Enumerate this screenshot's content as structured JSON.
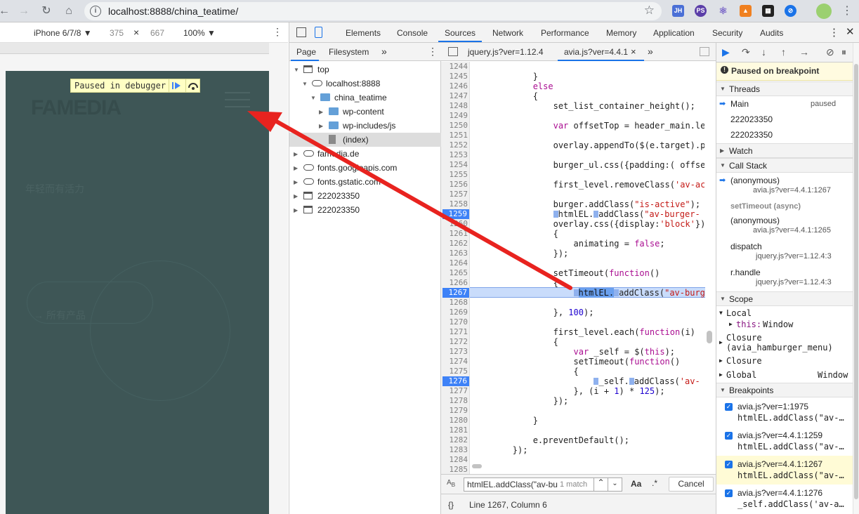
{
  "browser": {
    "url": "localhost:8888/china_teatime/",
    "nav_icons": [
      "back-icon",
      "forward-icon",
      "reload-icon",
      "home-icon"
    ],
    "extensions": [
      "JH",
      "PS",
      "⚛",
      "▲",
      "▦",
      "⊘"
    ]
  },
  "device_toolbar": {
    "device": "iPhone 6/7/8 ▼",
    "width": "375",
    "times": "×",
    "height": "667",
    "zoom": "100% ▼"
  },
  "page_preview": {
    "logo": "FAMEDIA",
    "debugger_label": "Paused in debugger",
    "faint_text_1": "年轻而有活力",
    "faint_text_2": "→  所有产品"
  },
  "devtools_tabs": [
    "Elements",
    "Console",
    "Sources",
    "Network",
    "Performance",
    "Memory",
    "Application",
    "Security",
    "Audits"
  ],
  "navigator": {
    "subtabs": [
      "Page",
      "Filesystem",
      "»"
    ],
    "tree": [
      {
        "label": "top",
        "depth": 0,
        "icon": "frame",
        "open": true
      },
      {
        "label": "localhost:8888",
        "depth": 1,
        "icon": "cloud",
        "open": true
      },
      {
        "label": "china_teatime",
        "depth": 2,
        "icon": "folder",
        "open": true
      },
      {
        "label": "wp-content",
        "depth": 3,
        "icon": "folder",
        "open": false
      },
      {
        "label": "wp-includes/js",
        "depth": 3,
        "icon": "folder",
        "open": false
      },
      {
        "label": "(index)",
        "depth": 3,
        "icon": "file",
        "selected": true
      },
      {
        "label": "famedia.de",
        "depth": 0,
        "icon": "cloud",
        "open": false
      },
      {
        "label": "fonts.googleapis.com",
        "depth": 0,
        "icon": "cloud",
        "open": false
      },
      {
        "label": "fonts.gstatic.com",
        "depth": 0,
        "icon": "cloud",
        "open": false
      },
      {
        "label": "222023350",
        "depth": 0,
        "icon": "frame",
        "open": false
      },
      {
        "label": "222023350",
        "depth": 0,
        "icon": "frame",
        "open": false
      }
    ]
  },
  "editor": {
    "tabs": [
      "jquery.js?ver=1.12.4",
      "avia.js?ver=4.4.1",
      "×",
      "»"
    ],
    "lines": [
      "1244",
      "1245",
      "1246",
      "1247",
      "1248",
      "1249",
      "1250",
      "1251",
      "1252",
      "1253",
      "1254",
      "1255",
      "1256",
      "1257",
      "1258",
      "1259",
      "1260",
      "1261",
      "1262",
      "1263",
      "1264",
      "1265",
      "1266",
      "1267",
      "1268",
      "1269",
      "1270",
      "1271",
      "1272",
      "1273",
      "1274",
      "1275",
      "1276",
      "1277",
      "1278",
      "1279",
      "1280",
      "1281",
      "1282",
      "1283",
      "1284",
      "1285"
    ],
    "search": {
      "value": "htmlEL.addClass(\"av-bu",
      "matches": "1 match",
      "aa": "Aa",
      "regex": ".*",
      "cancel": "Cancel"
    },
    "status": {
      "braces": "{}",
      "position": "Line 1267, Column 6"
    }
  },
  "debugger": {
    "paused_banner": "Paused on breakpoint",
    "threads_header": "Threads",
    "threads": [
      {
        "name": "Main",
        "state": "paused"
      },
      {
        "name": "222023350",
        "state": ""
      },
      {
        "name": "222023350",
        "state": ""
      }
    ],
    "watch_header": "Watch",
    "callstack_header": "Call Stack",
    "callstack": [
      {
        "fn": "(anonymous)",
        "loc": "avia.js?ver=4.4.1:1267"
      },
      {
        "fn": "setTimeout (async)",
        "loc": ""
      },
      {
        "fn": "(anonymous)",
        "loc": "avia.js?ver=4.4.1:1265"
      },
      {
        "fn": "dispatch",
        "loc": "jquery.js?ver=1.12.4:3"
      },
      {
        "fn": "r.handle",
        "loc": "jquery.js?ver=1.12.4:3"
      }
    ],
    "scope_header": "Scope",
    "scope": {
      "local": "Local",
      "this_key": "this:",
      "this_val": "Window",
      "closure1": "Closure",
      "closure1_name": "(avia_hamburger_menu)",
      "closure2": "Closure",
      "global": "Global",
      "global_val": "Window"
    },
    "breakpoints_header": "Breakpoints",
    "breakpoints": [
      {
        "file": "avia.js?ver=1:1975",
        "code": "htmlEL.addClass(\"av-…"
      },
      {
        "file": "avia.js?ver=4.4.1:1259",
        "code": "htmlEL.addClass(\"av-…"
      },
      {
        "file": "avia.js?ver=4.4.1:1267",
        "code": "htmlEL.addClass(\"av-…"
      },
      {
        "file": "avia.js?ver=4.4.1:1276",
        "code": "_self.addClass('av-a…"
      }
    ]
  },
  "colors": {
    "accent": "#1a73e8",
    "breakpoint": "#3e82f7",
    "arrow": "#e8231f",
    "paused_bg": "#ffffc4"
  }
}
